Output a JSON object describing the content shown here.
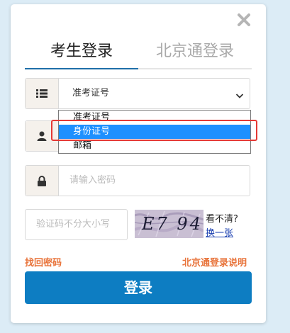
{
  "tabs": [
    {
      "label": "考生登录",
      "active": true
    },
    {
      "label": "北京通登录",
      "active": false
    }
  ],
  "id_type_select": {
    "selected": "准考证号",
    "options": [
      "准考证号",
      "身份证号",
      "邮箱"
    ],
    "highlighted_option": "身份证号"
  },
  "password": {
    "placeholder": "请输入密码"
  },
  "captcha": {
    "placeholder": "验证码不分大小写",
    "image_text": "E7 94",
    "unclear_label": "看不清?",
    "refresh_label": "换一张"
  },
  "links": {
    "forgot_password": "找回密码",
    "beijingtong_help": "北京通登录说明"
  },
  "login_button": "登录",
  "colors": {
    "primary": "#0d7dc2",
    "link_orange": "#e8733a",
    "option_selected": "#1e90ff",
    "highlight_red": "#e53935"
  }
}
